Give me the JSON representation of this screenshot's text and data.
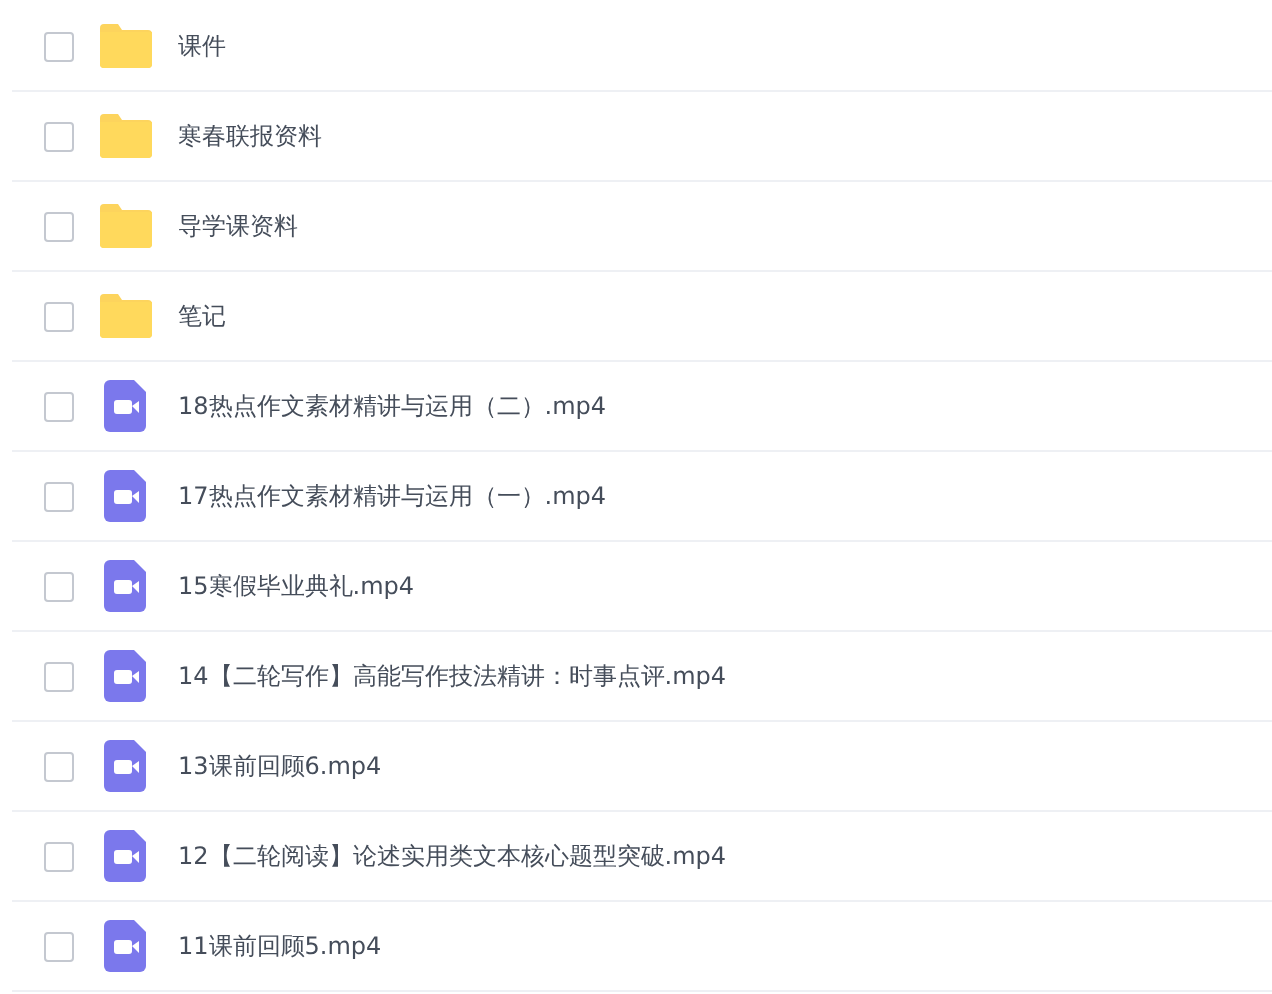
{
  "files": [
    {
      "kind": "folder",
      "name": "课件",
      "checked": false
    },
    {
      "kind": "folder",
      "name": "寒春联报资料",
      "checked": false
    },
    {
      "kind": "folder",
      "name": "导学课资料",
      "checked": false
    },
    {
      "kind": "folder",
      "name": "笔记",
      "checked": false
    },
    {
      "kind": "video",
      "name": "18热点作文素材精讲与运用（二）.mp4",
      "checked": false
    },
    {
      "kind": "video",
      "name": "17热点作文素材精讲与运用（一）.mp4",
      "checked": false
    },
    {
      "kind": "video",
      "name": "15寒假毕业典礼.mp4",
      "checked": false
    },
    {
      "kind": "video",
      "name": "14【二轮写作】高能写作技法精讲：时事点评.mp4",
      "checked": false
    },
    {
      "kind": "video",
      "name": "13课前回顾6.mp4",
      "checked": false
    },
    {
      "kind": "video",
      "name": "12【二轮阅读】论述实用类文本核心题型突破.mp4",
      "checked": false
    },
    {
      "kind": "video",
      "name": "11课前回顾5.mp4",
      "checked": false
    }
  ]
}
